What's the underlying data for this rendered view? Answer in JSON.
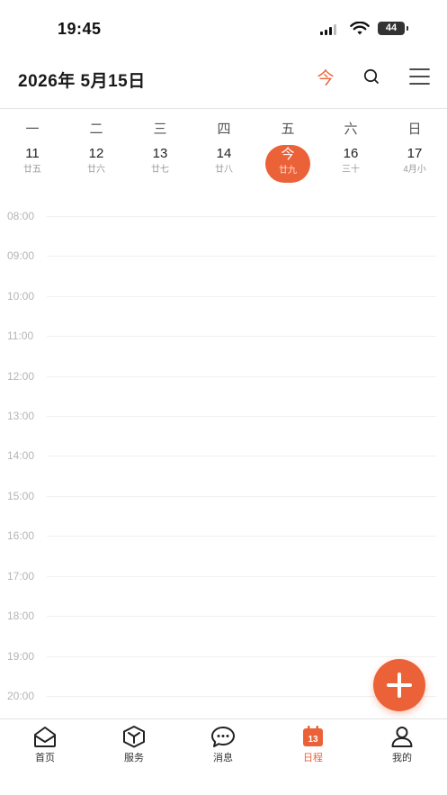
{
  "status_bar": {
    "time": "19:45",
    "battery": "44"
  },
  "header": {
    "date_title": "2026年 5月15日",
    "today_label": "今",
    "icons": [
      "search-icon",
      "menu-icon"
    ]
  },
  "week": {
    "weekdays": [
      "一",
      "二",
      "三",
      "四",
      "五",
      "六",
      "日"
    ],
    "dates": [
      {
        "day": "11",
        "lunar": "廿五"
      },
      {
        "day": "12",
        "lunar": "廿六"
      },
      {
        "day": "13",
        "lunar": "廿七"
      },
      {
        "day": "14",
        "lunar": "廿八"
      },
      {
        "day": "今",
        "lunar": "廿九"
      },
      {
        "day": "16",
        "lunar": "三十"
      },
      {
        "day": "17",
        "lunar": "4月小"
      }
    ]
  },
  "timeline": {
    "hours": [
      "08:00",
      "09:00",
      "10:00",
      "11:00",
      "12:00",
      "13:00",
      "14:00",
      "15:00",
      "16:00",
      "17:00",
      "18:00",
      "19:00",
      "20:00"
    ]
  },
  "fab": {
    "icon": "plus-icon"
  },
  "tabbar": {
    "tabs": [
      {
        "label": "首页",
        "icon": "home-icon"
      },
      {
        "label": "服务",
        "icon": "service-cube-icon"
      },
      {
        "label": "消息",
        "icon": "message-bubble-icon"
      },
      {
        "label": "日程",
        "icon": "calendar-icon",
        "badge": "13"
      },
      {
        "label": "我的",
        "icon": "profile-icon"
      }
    ],
    "active": "日程"
  },
  "colors": {
    "accent": "#ec6238",
    "text": "#222222",
    "muted": "#b5b5b5"
  }
}
